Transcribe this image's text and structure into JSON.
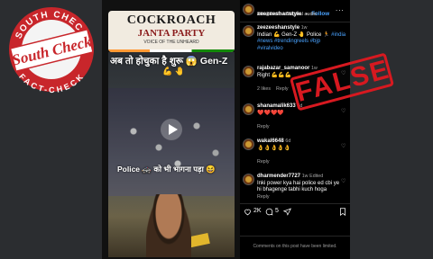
{
  "banner": {
    "title": "COCKROACH",
    "subtitle": "JANTA PARTY",
    "tagline": "VOICE OF THE UNHEARD"
  },
  "video": {
    "overlay_top": "अब तो होचुका है शुरू 😱 Gen-Z",
    "overlay_emojis": "💪 🤚",
    "overlay_bottom": "Police 🚓 को भी भागना पड़ा 😆"
  },
  "post": {
    "username": "zeezeeshanstyle",
    "dot": "•",
    "follow_label": "Follow",
    "audio": "nitingillsolo • Original audio",
    "caption_user": "zeezeeshanstyle",
    "caption_time": "1w",
    "caption_text": "Indian 💪 Gen-Z 🤚 Police 🏃 ",
    "caption_tags": "#india #news #trendingreels #bjp #viralvideo",
    "more_icon": "..."
  },
  "comments": [
    {
      "user": "rajabazar_samanoor",
      "time": "1w",
      "text": "Right 💪💪💪",
      "likes": "2 likes",
      "reply": "Reply"
    },
    {
      "user": "shanamalik633",
      "time": "6d",
      "text": "❤️❤️❤️❤️",
      "reply": "Reply"
    },
    {
      "user": "wakal6648",
      "time": "6d",
      "text": "👌👌👌👌👌",
      "reply": "Reply"
    },
    {
      "user": "dharmender7727",
      "time": "1w",
      "edited": "Edited",
      "text": "Inki power kya hai police ed cbi ye hi bhagenge tabhi kuch hoga",
      "reply": "Reply"
    }
  ],
  "actions": {
    "likes_count": "2K",
    "comments_count": "5"
  },
  "footer": {
    "limited": "Comments on this post have been limited."
  },
  "badge": {
    "top_text": "SOUTH CHECK",
    "bottom_text": "FACT-CHECK",
    "logo_text": "South Check"
  },
  "stamp": {
    "label": "FALSE"
  },
  "colors": {
    "accent_blue": "#4aa3ff",
    "stamp_red": "#d71920",
    "badge_red": "#c8262b"
  }
}
